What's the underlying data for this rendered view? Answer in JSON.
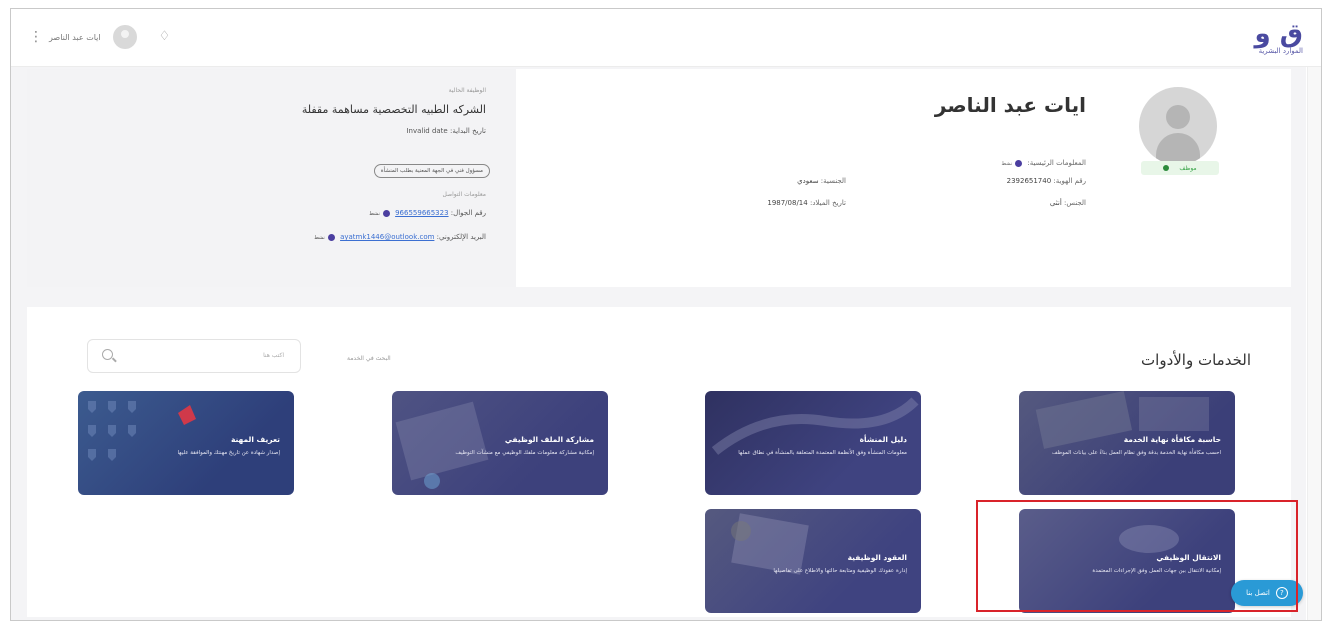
{
  "header": {
    "logo_text": "ق و",
    "logo_subtitle": "الموارد البشرية",
    "user_name": "ايات عبد الناصر",
    "menu_icon": "kebab-icon",
    "bell_icon": "bell-icon"
  },
  "profile": {
    "name": "ايات عبد الناصر",
    "status_label": "موظف",
    "fields": {
      "main_status_label": "المعلومات الرئيسية",
      "main_status_value": "نشط",
      "id_label": "رقم الهوية",
      "id_value": "2392651740",
      "gender_label": "الجنس",
      "gender_value": "أنثى",
      "nationality_label": "الجنسية",
      "nationality_value": "سعودي",
      "birth_label": "تاريخ الميلاد",
      "birth_value": "1987/08/14"
    },
    "employer": {
      "section_label": "الوظيفة الحالية",
      "company": "الشركه الطبيه التخصصية مساهمة مقفلة",
      "date_label": "تاريخ البداية",
      "date_value": "Invalid date",
      "chip": "مسؤول فني في الجهة المعنية بطلب المنشأة",
      "contact_label": "معلومات التواصل",
      "phone_label": "رقم الجوال",
      "phone_value": "966559665323",
      "phone_badge": "نشط",
      "email_label": "البريد الإلكتروني",
      "email_value": "ayatmk1446@outlook.com",
      "email_badge": "نشط"
    }
  },
  "services": {
    "title": "الخدمات والأدوات",
    "search_label": "البحث في الخدمة",
    "search_placeholder": "اكتب هنا",
    "cards": [
      {
        "title": "حاسبة مكافأة نهاية الخدمة",
        "desc": "احسب مكافأة نهاية الخدمة بدقة وفق نظام العمل بناءً على بيانات الموظف"
      },
      {
        "title": "دليل المنشأة",
        "desc": "معلومات المنشأة وفق الأنظمة المعتمدة المتعلقة بالمنشأة في نطاق عملها"
      },
      {
        "title": "مشاركة الملف الوظيفي",
        "desc": "إمكانية مشاركة معلومات ملفك الوظيفي مع منشآت التوظيف"
      },
      {
        "title": "تعريف المهنة",
        "desc": "إصدار شهادة عن تاريخ مهنتك والموافقة عليها"
      },
      {
        "title": "الانتقال الوظيفي",
        "desc": "إمكانية الانتقال بين جهات العمل وفق الإجراءات المعتمدة"
      },
      {
        "title": "العقود الوظيفية",
        "desc": "إدارة عقودك الوظيفية ومتابعة حالتها والاطلاع على تفاصيلها"
      }
    ]
  },
  "help": {
    "label": "اتصل بنا"
  }
}
